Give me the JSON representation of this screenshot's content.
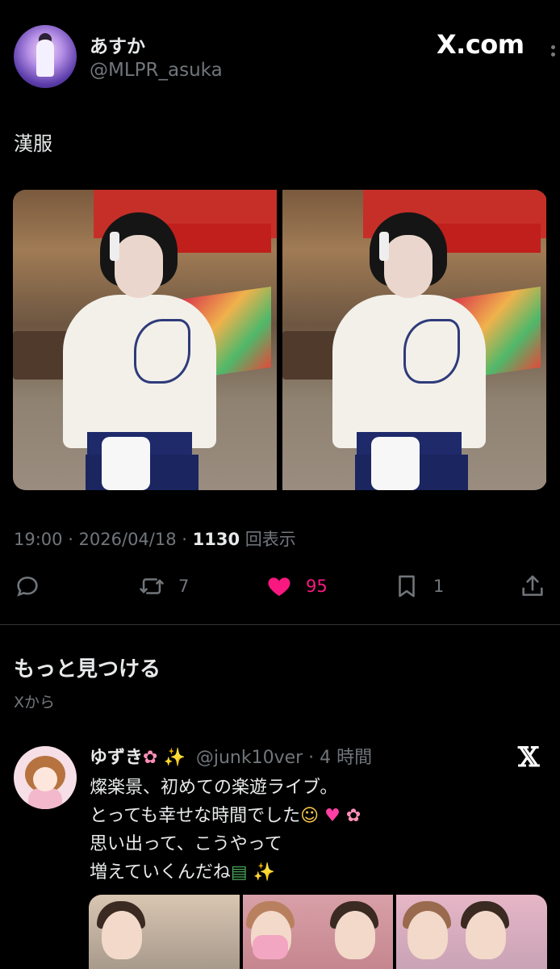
{
  "post": {
    "author_name": "あすか",
    "author_handle": "@MLPR_asuka",
    "brand": "X.com",
    "text": "漢服",
    "time": "19:00 · 2026/04/18 · ",
    "views_count": "1130",
    "views_label": " 回表示",
    "photos": [
      "photo-1",
      "photo-2"
    ]
  },
  "actions": {
    "reply": {
      "icon": "reply-icon",
      "count": ""
    },
    "repost": {
      "icon": "repost-icon",
      "count": "7"
    },
    "like": {
      "icon": "heart-icon",
      "count": "95",
      "color": "#f91880"
    },
    "bookmark": {
      "icon": "bookmark-icon",
      "count": "1"
    },
    "share": {
      "icon": "share-icon",
      "count": ""
    }
  },
  "discover": {
    "title": "もっと見つける",
    "subtitle": "Xから"
  },
  "recommended": {
    "name": "ゆずき",
    "handle": "@junk10ver · 4 時間",
    "lines": [
      "燦楽景、初めての楽遊ライブ。",
      "とっても幸せな時間でした",
      "思い出って、こうやって",
      "増えていくんだね"
    ],
    "emoji": {
      "flower": "✿",
      "sparkles": "✨",
      "pleading": "☺",
      "heart": "♥",
      "books": "▤"
    }
  },
  "colors": {
    "background": "#000000",
    "text": "#e7e9ea",
    "muted": "#71767b",
    "like": "#f91880",
    "divider": "#2f3336"
  }
}
